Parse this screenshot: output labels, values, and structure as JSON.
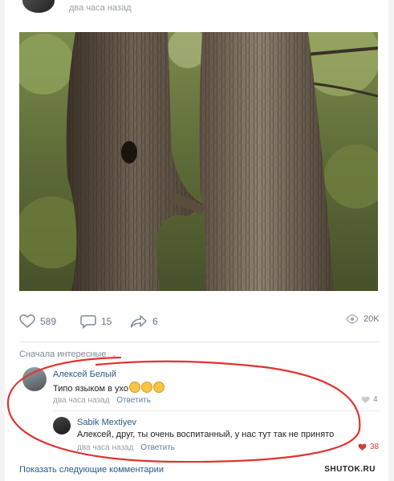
{
  "post": {
    "time": "два часа назад"
  },
  "actions": {
    "likes": "589",
    "comments": "15",
    "shares": "6",
    "views": "20K"
  },
  "comments_sort": "Сначала интересные",
  "comments": [
    {
      "author": "Алексей Белый",
      "text": "Типо языком в ухо",
      "emoji_count": 3,
      "time": "два часа назад",
      "reply_label": "Ответить",
      "likes": "4"
    },
    {
      "author": "Sabik Mextiyev",
      "text": "Алексей, друг, ты очень воспитанный, у нас тут так не принято",
      "time": "два часа назад",
      "reply_label": "Ответить",
      "likes": "38"
    }
  ],
  "show_more": "Показать следующие комментарии",
  "watermark": "SHUTOK.RU",
  "colors": {
    "link": "#2a5885",
    "muted": "#9aa0a6",
    "like_red": "#d23b3b",
    "annotation_red": "#e0332f"
  }
}
